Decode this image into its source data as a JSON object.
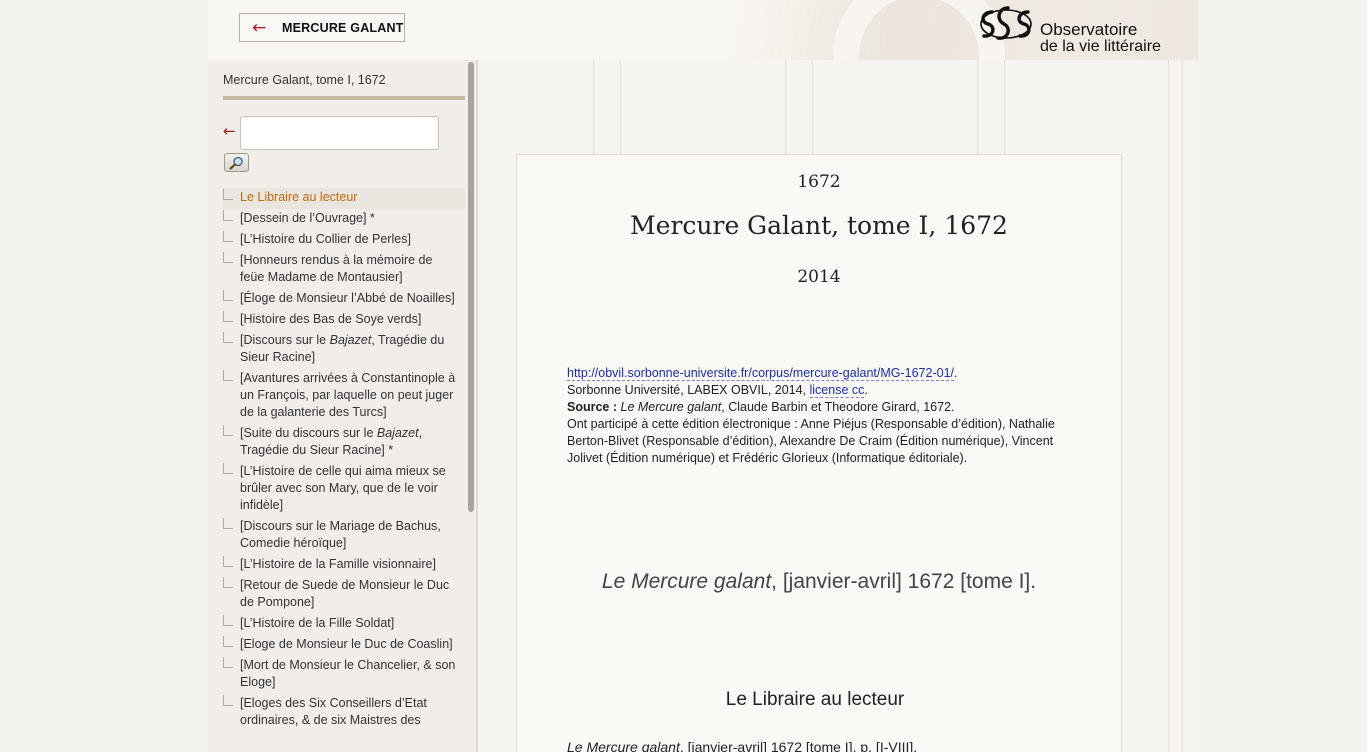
{
  "header": {
    "back_label": "MERCURE GALANT",
    "back_arrow": "←",
    "logo_line1": "Observatoire",
    "logo_line2": "de la vie littéraire"
  },
  "sidebar": {
    "title": "Mercure Galant, tome I, 1672",
    "search_back_arrow": "←",
    "search_value": "",
    "search_button_icon": "magnifier-icon",
    "toc": [
      {
        "label": "Le Libraire au lecteur",
        "active": true
      },
      {
        "label": "[Dessein de l’Ouvrage] *"
      },
      {
        "label": "[L’Histoire du Collier de Perles]"
      },
      {
        "label": "[Honneurs rendus à la mémoire de feüe Madame de Montausier]"
      },
      {
        "label": "[Éloge de Monsieur l’Abbé de Noailles]"
      },
      {
        "label": "[Histoire des Bas de Soye verds]"
      },
      {
        "label_pre": "[Discours sur le ",
        "label_em": "Bajazet",
        "label_post": ", Tragédie du Sieur Racine]"
      },
      {
        "label": "[Avantures arrivées à Constantinople à un François, par laquelle on peut juger de la galanterie des Turcs]"
      },
      {
        "label_pre": "[Suite du discours sur le ",
        "label_em": "Bajazet",
        "label_post": ", Tragédie du Sieur Racine] *"
      },
      {
        "label": "[L’Histoire de celle qui aima mieux se brûler avec son Mary, que de le voir infidèle]"
      },
      {
        "label": "[Discours sur le Mariage de Bachus, Comedie héroïque]"
      },
      {
        "label": "[L’Histoire de la Famille visionnaire]"
      },
      {
        "label": "[Retour de Suede de Monsieur le Duc de Pompone]"
      },
      {
        "label": "[L’Histoire de la Fille Soldat]"
      },
      {
        "label": "[Eloge de Monsieur le Duc de Coaslin]"
      },
      {
        "label": "[Mort de Monsieur le Chancelier, & son Eloge]"
      },
      {
        "label": "[Eloges des Six Conseillers d’Etat ordinaires, & de six Maistres des"
      }
    ]
  },
  "document": {
    "year": "1672",
    "title": "Mercure Galant, tome I, 1672",
    "pub_year": "2014",
    "url": "http://obvil.sorbonne-universite.fr/corpus/mercure-galant/MG-1672-01/",
    "url_suffix": ".",
    "publisher_pre": "Sorbonne Université, LABEX OBVIL, 2014, ",
    "license": "license cc",
    "license_suffix": ".",
    "source_label": "Source :",
    "source_em": "Le Mercure galant",
    "source_rest": ", Claude Barbin et Theodore Girard, 1672.",
    "contributors": "Ont participé à cette édition électronique : Anne Piéjus (Responsable d’édition), Nathalie Berton-Blivet (Responsable d’édition), Alexandre De Craim (Édition numérique), Vincent Jolivet (Édition numérique) et Frédéric Glorieux (Informatique éditoriale).",
    "cite_em": "Le Mercure galant",
    "cite_rest": ", [janvier-avril] 1672 [tome I].",
    "section_heading": "Le Libraire au lecteur",
    "bottom_cite_em": "Le Mercure galant",
    "bottom_cite_rest": ", [janvier-avril] 1672 [tome I], p. [I-VIII]."
  }
}
